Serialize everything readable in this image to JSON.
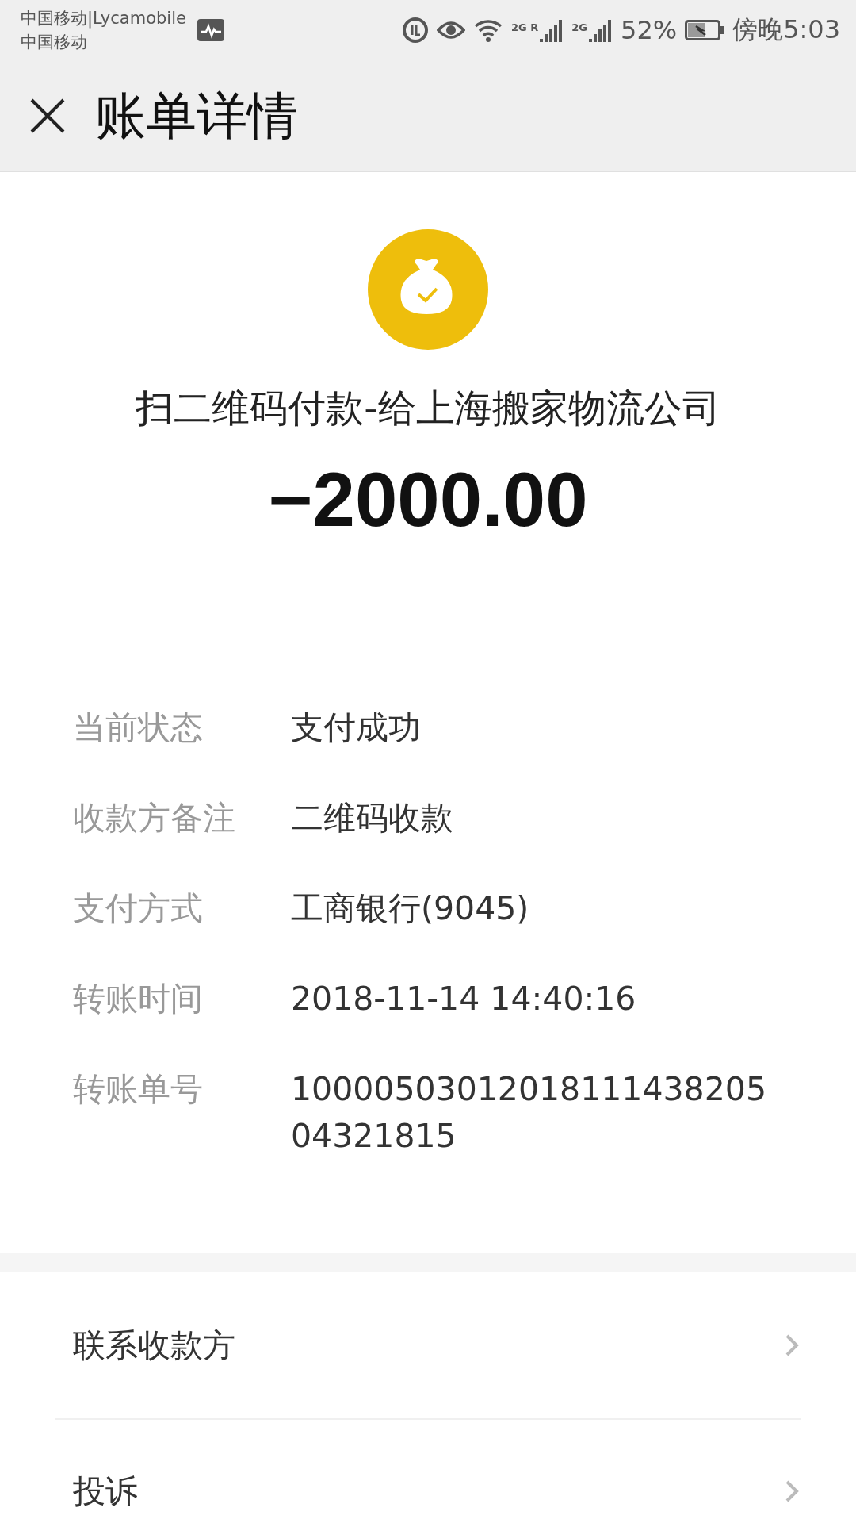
{
  "status_bar": {
    "carriers": [
      "中国移动|Lycamobile",
      "中国移动"
    ],
    "signals": [
      {
        "label": "2G",
        "roaming": "R"
      },
      {
        "label": "2G"
      }
    ],
    "battery_text": "52%",
    "time": "傍晚5:03"
  },
  "header": {
    "title": "账单详情"
  },
  "summary": {
    "payee": "扫二维码付款-给上海搬家物流公司",
    "amount": "−2000.00"
  },
  "details": [
    {
      "label": "当前状态",
      "value": "支付成功"
    },
    {
      "label": "收款方备注",
      "value": "二维码收款"
    },
    {
      "label": "支付方式",
      "value": "工商银行(9045)"
    },
    {
      "label": "转账时间",
      "value": "2018-11-14 14:40:16"
    },
    {
      "label": "转账单号",
      "value": "1000050301201811143820504321815"
    }
  ],
  "actions": [
    {
      "label": "联系收款方"
    },
    {
      "label": "投诉"
    }
  ]
}
